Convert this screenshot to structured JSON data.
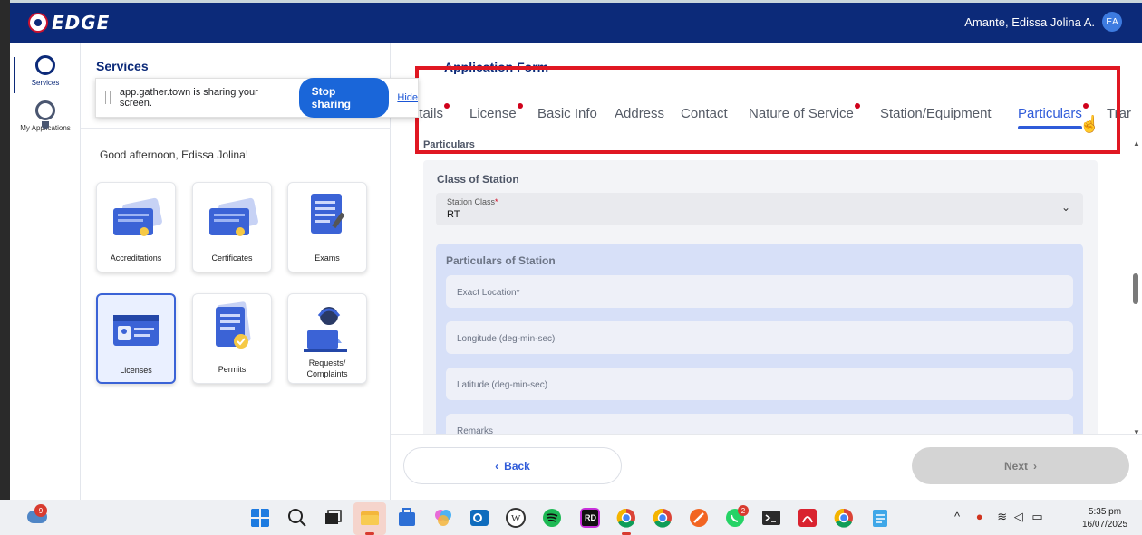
{
  "header": {
    "logo_text": "EDGE",
    "user_name": "Amante, Edissa Jolina A.",
    "avatar_initials": "EA"
  },
  "sidenav": {
    "items": [
      {
        "label": "Services",
        "icon": "signal-tower-icon",
        "active": true
      },
      {
        "label": "My Applications",
        "icon": "ribbon-badge-icon",
        "active": false
      }
    ]
  },
  "services": {
    "title": "Services",
    "greeting": "Good afternoon, Edissa Jolina!",
    "tiles": [
      {
        "label": "Accreditations",
        "icon": "certificate-icon",
        "selected": false
      },
      {
        "label": "Certificates",
        "icon": "certificate-icon",
        "selected": false
      },
      {
        "label": "Exams",
        "icon": "exam-document-icon",
        "selected": false
      },
      {
        "label": "Licenses",
        "icon": "id-card-icon",
        "selected": true
      },
      {
        "label": "Permits",
        "icon": "permit-document-icon",
        "selected": false
      },
      {
        "label": "Requests/ Complaints",
        "icon": "support-agent-icon",
        "selected": false
      }
    ]
  },
  "sharebar": {
    "message": "app.gather.town is sharing your screen.",
    "stop_label": "Stop sharing",
    "hide_label": "Hide"
  },
  "form": {
    "title": "Application Form",
    "tabs": [
      {
        "label": "Details",
        "visible_text": "etails",
        "dot": true
      },
      {
        "label": "License",
        "dot": true
      },
      {
        "label": "Basic Info",
        "dot": false
      },
      {
        "label": "Address",
        "dot": false
      },
      {
        "label": "Contact",
        "dot": false
      },
      {
        "label": "Nature of Service",
        "dot": true
      },
      {
        "label": "Station/Equipment",
        "dot": false
      },
      {
        "label": "Particulars",
        "dot": true,
        "active": true
      },
      {
        "label": "Trar",
        "dot": false
      }
    ],
    "section_label": "Particulars",
    "class_of_station": {
      "title": "Class of Station",
      "field_label": "Station Class",
      "required_mark": "*",
      "value": "RT"
    },
    "particulars_of_station": {
      "title": "Particulars of Station",
      "fields": [
        {
          "placeholder": "Exact Location*"
        },
        {
          "placeholder": "Longitude (deg-min-sec)"
        },
        {
          "placeholder": "Latitude (deg-min-sec)"
        },
        {
          "placeholder": "Remarks"
        }
      ]
    },
    "back_label": "Back",
    "next_label": "Next"
  },
  "taskbar": {
    "weather_badge": "9",
    "whatsapp_badge": "2",
    "time": "5:35 pm",
    "date": "16/07/2025",
    "apps": [
      "windows-start-icon",
      "search-icon",
      "task-view-icon",
      "file-explorer-icon",
      "microsoft-store-icon",
      "copilot-icon",
      "outlook-icon",
      "wordpress-icon",
      "spotify-icon",
      "rider-icon",
      "chrome-icon",
      "chrome-profile-icon",
      "toolbox-icon",
      "whatsapp-icon",
      "terminal-icon",
      "acrobat-icon",
      "chrome-alt-icon",
      "notepad-icon"
    ]
  },
  "colors": {
    "brand_navy": "#0c2a79",
    "accent_blue": "#2f5bd9",
    "highlight_red": "#e01722",
    "required_dot": "#d0021b"
  }
}
